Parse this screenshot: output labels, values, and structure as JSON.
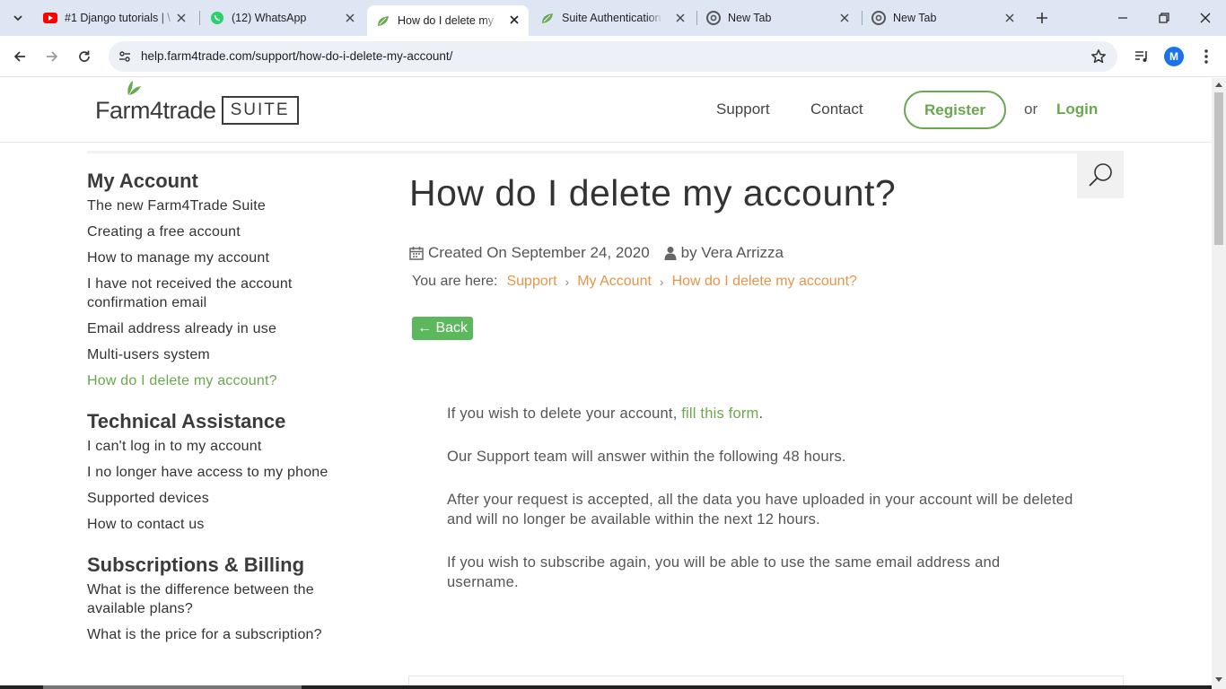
{
  "browser": {
    "tabs": [
      {
        "title": "#1 Django tutorials | \\",
        "favicon": "youtube-icon"
      },
      {
        "title": "(12) WhatsApp",
        "favicon": "whatsapp-icon"
      },
      {
        "title": "How do I delete my a",
        "favicon": "farm4trade-leaf-icon",
        "active": true
      },
      {
        "title": "Suite Authentication-",
        "favicon": "farm4trade-leaf-icon"
      },
      {
        "title": "New Tab",
        "favicon": "chrome-icon"
      },
      {
        "title": "New Tab",
        "favicon": "chrome-icon"
      }
    ],
    "url": "help.farm4trade.com/support/how-do-i-delete-my-account/",
    "profile_initial": "M"
  },
  "site": {
    "logo_word": "Farm4trade",
    "logo_suite": "SUITE",
    "nav": {
      "support": "Support",
      "contact": "Contact",
      "register": "Register",
      "or": "or",
      "login": "Login"
    }
  },
  "sidebar": {
    "groups": [
      {
        "heading": "My Account",
        "items": [
          "The new Farm4Trade Suite",
          "Creating a free account",
          "How to manage my account",
          "I have not received the account confirmation email",
          "Email address already in use",
          "Multi-users system",
          "How do I delete my account?"
        ]
      },
      {
        "heading": "Technical Assistance",
        "items": [
          "I can't log in to my account",
          "I no longer have access to my phone",
          "Supported devices",
          "How to contact us"
        ]
      },
      {
        "heading": "Subscriptions & Billing",
        "items": [
          "What is the difference between the available plans?",
          "What is the price for a subscription?"
        ]
      }
    ]
  },
  "article": {
    "title": "How do I delete my account?",
    "created": "Created On September 24, 2020",
    "author": "by Vera Arrizza",
    "you_are_here": "You are here:",
    "crumbs": [
      "Support",
      "My Account",
      "How do I delete my account?"
    ],
    "back": "← Back",
    "p1_before": "If you wish to delete your account, ",
    "p1_link": "fill this form",
    "p1_after": ".",
    "p2": "Our Support team will answer within the following 48 hours.",
    "p3": "After your request is accepted, all the data you have uploaded in your account will be deleted and will no longer be available within the next 12 hours.",
    "p4": "If you wish to subscribe again, you will be able to use the same email address and username."
  },
  "colors": {
    "brand_green": "#6aa84f",
    "crumb_orange": "#e3954a",
    "back_green": "#5cb85c"
  }
}
